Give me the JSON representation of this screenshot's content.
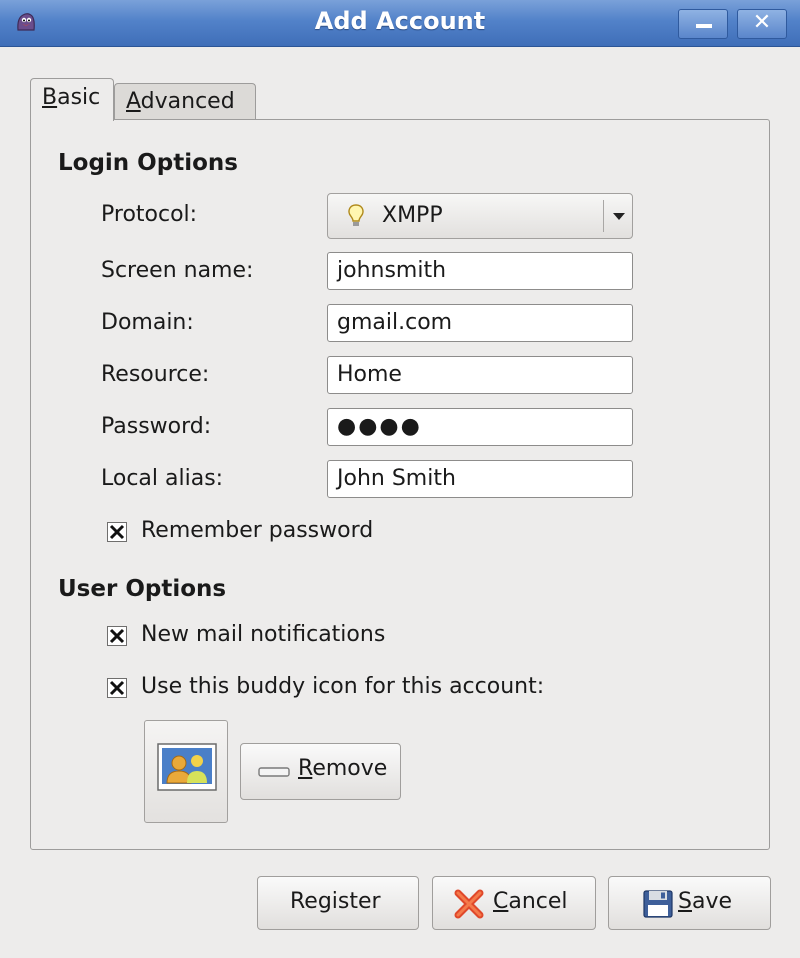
{
  "window": {
    "title": "Add Account"
  },
  "tabs": [
    {
      "label_mnemonic": "B",
      "label_rest": "asic",
      "selected": true
    },
    {
      "label_mnemonic": "A",
      "label_rest": "dvanced",
      "selected": false
    }
  ],
  "login_options": {
    "heading": "Login Options",
    "protocol": {
      "label": "Protocol:",
      "value": "XMPP"
    },
    "screen_name": {
      "label": "Screen name:",
      "value": "johnsmith"
    },
    "domain": {
      "label": "Domain:",
      "value": "gmail.com"
    },
    "resource": {
      "label": "Resource:",
      "value": "Home"
    },
    "password": {
      "label": "Password:",
      "value": "●●●●"
    },
    "local_alias": {
      "label": "Local alias:",
      "value": "John Smith"
    },
    "remember_password": {
      "label": "Remember password",
      "checked": true
    }
  },
  "user_options": {
    "heading": "User Options",
    "new_mail": {
      "label": "New mail notifications",
      "checked": true
    },
    "buddy_icon": {
      "label": "Use this buddy icon for this account:",
      "checked": true
    },
    "remove_button": {
      "mnemonic": "R",
      "rest": "emove"
    }
  },
  "buttons": {
    "register": "Register",
    "cancel": {
      "mnemonic": "C",
      "rest": "ancel"
    },
    "save": {
      "mnemonic": "S",
      "rest": "ave"
    }
  },
  "icons": {
    "app": "pidgin-icon",
    "protocol": "lightbulb-icon",
    "buddy": "buddy-picture-icon",
    "remove": "minus-icon",
    "cancel": "red-x-icon",
    "save": "floppy-disk-icon"
  },
  "colors": {
    "titlebar": "#5282c9",
    "window_bg": "#edeceb",
    "cancel_x": "#e0482a",
    "save_disk": "#3e5f9a"
  }
}
